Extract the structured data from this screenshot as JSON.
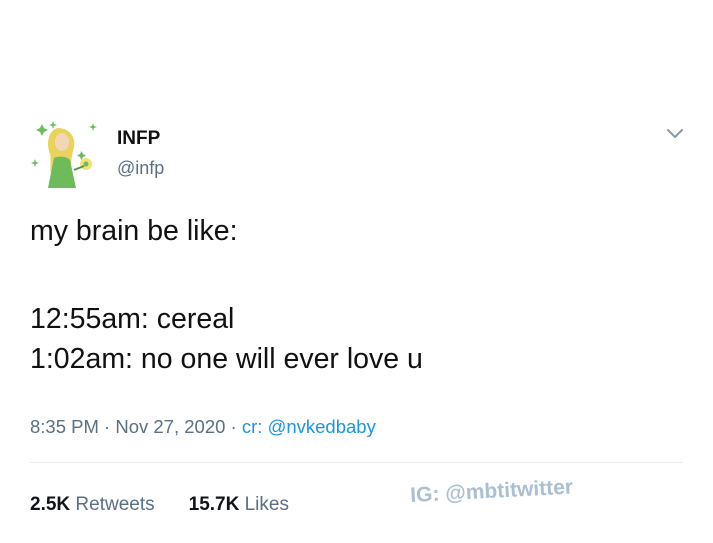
{
  "tweet": {
    "display_name": "INFP",
    "handle": "@infp",
    "lines": [
      "my brain be like:",
      "12:55am: cereal",
      "1:02am: no one will ever love u"
    ],
    "time": "8:35 PM",
    "separator": " · ",
    "date": "Nov 27, 2020",
    "credit": "cr: @nvkedbaby",
    "menu_icon": "chevron-down-icon"
  },
  "stats": {
    "retweets_count": "2.5K",
    "retweets_label": "Retweets",
    "likes_count": "15.7K",
    "likes_label": "Likes"
  },
  "watermark": "IG: @mbtitwitter",
  "colors": {
    "secondary_text": "#5b7083",
    "link": "#1b95e0",
    "avatar_green": "#6dbb5a",
    "avatar_yellow": "#e8d35c"
  }
}
